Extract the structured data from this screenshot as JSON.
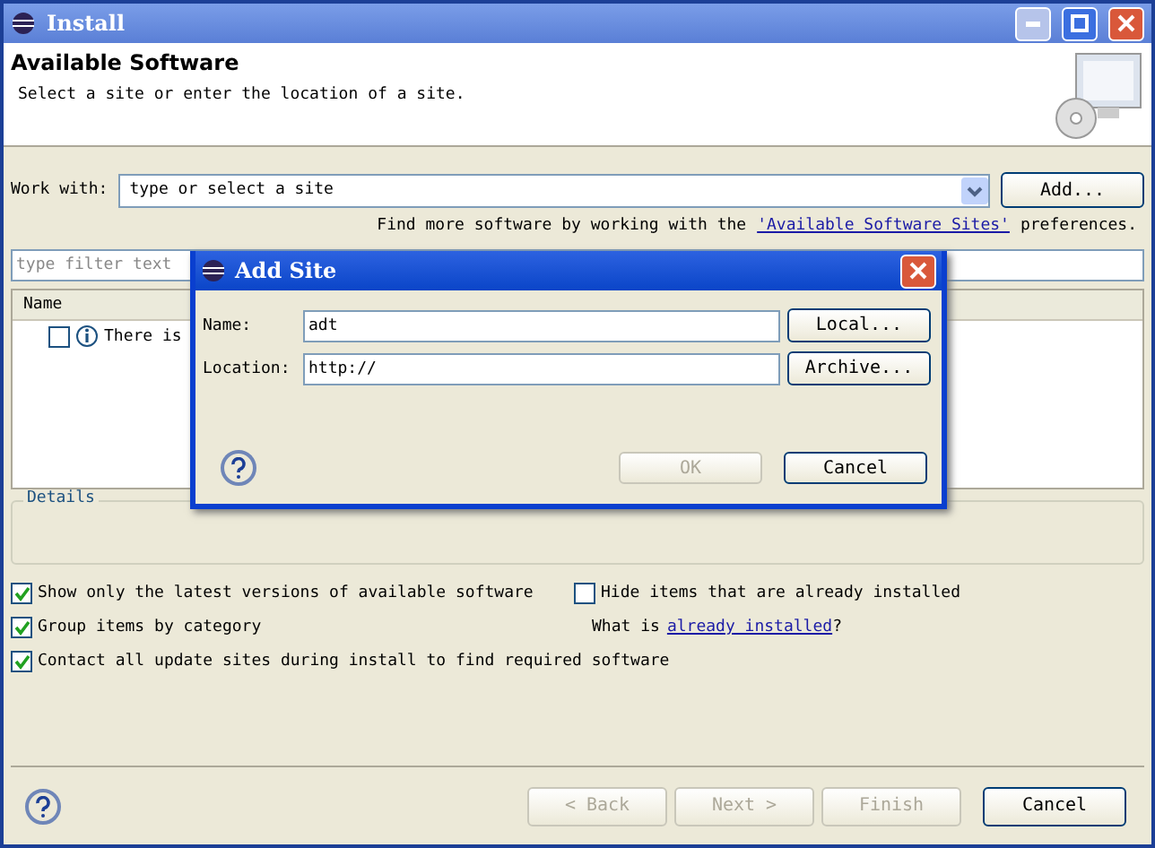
{
  "window": {
    "title": "Install"
  },
  "header": {
    "title": "Available Software",
    "subtitle": "Select a site or enter the location of a site."
  },
  "work_with": {
    "label": "Work with:",
    "placeholder": "type or select a site",
    "add_button": "Add..."
  },
  "find_more": {
    "text": "Find more software by working with the",
    "link": "'Available Software Sites'",
    "suffix": "preferences."
  },
  "filter": {
    "placeholder": "type filter text"
  },
  "tree": {
    "column": "Name",
    "items": [
      {
        "label": "There is",
        "checked": false
      }
    ]
  },
  "details": {
    "label": "Details"
  },
  "options": [
    {
      "label": "Show only the latest versions of available software",
      "checked": true
    },
    {
      "label": "Hide items that are already installed",
      "checked": false
    },
    {
      "label": "Group items by category",
      "checked": true
    },
    {
      "label": "Contact all update sites during install to find required software",
      "checked": true
    }
  ],
  "installed_hint": {
    "text": "What is",
    "link": "already installed",
    "suffix": "?"
  },
  "buttons": [
    {
      "label": "< Back",
      "disabled": true
    },
    {
      "label": "Next >",
      "disabled": true
    },
    {
      "label": "Finish",
      "disabled": true
    },
    {
      "label": "Cancel",
      "disabled": false
    }
  ],
  "dialog": {
    "title": "Add Site",
    "fields": [
      {
        "label": "Name:",
        "value": "adt",
        "button": "Local..."
      },
      {
        "label": "Location:",
        "value": "http://",
        "button": "Archive..."
      }
    ],
    "buttons": [
      {
        "label": "OK",
        "disabled": true
      },
      {
        "label": "Cancel",
        "disabled": false
      }
    ]
  }
}
